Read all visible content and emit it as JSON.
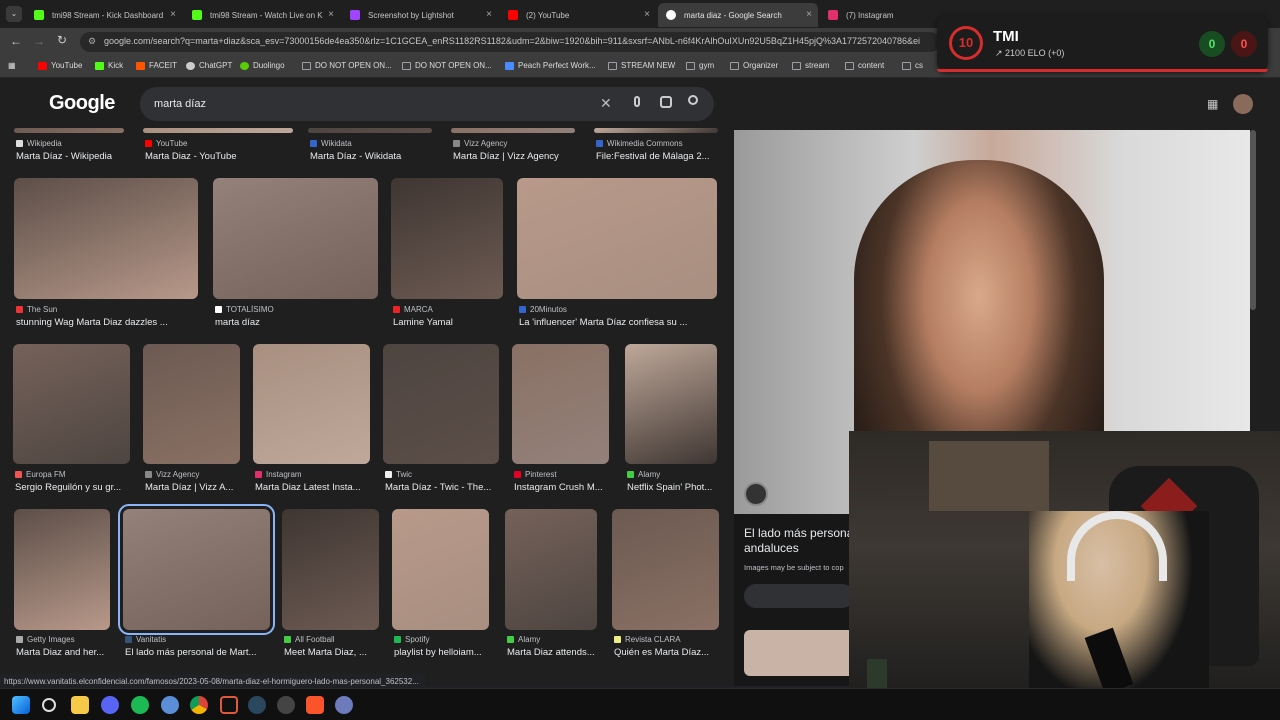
{
  "tabs": [
    {
      "label": "tmi98 Stream - Kick Dashboard",
      "color": "#53fc18"
    },
    {
      "label": "tmi98 Stream - Watch Live on K",
      "color": "#53fc18"
    },
    {
      "label": "Screenshot by Lightshot",
      "color": "#a044ff"
    },
    {
      "label": "(2) YouTube",
      "color": "#ff0000"
    },
    {
      "label": "marta diaz - Google Search",
      "color": "#ffffff"
    },
    {
      "label": "(7) Instagram",
      "color": "#e1306c"
    }
  ],
  "url": "google.com/search?q=marta+diaz&sca_esv=73000156de4ea350&rlz=1C1GCEA_enRS1182RS1182&udm=2&biw=1920&bih=911&sxsrf=ANbL-n6f4KrAlhOuIXUn92U5BqZ1H45pjQ%3A1772572040786&ei",
  "bookmarks": [
    {
      "label": "YouTube",
      "color": "#ff0000"
    },
    {
      "label": "Kick",
      "color": "#53fc18"
    },
    {
      "label": "FACEIT",
      "color": "#ff5500"
    },
    {
      "label": "ChatGPT",
      "color": "#cccccc"
    },
    {
      "label": "Duolingo",
      "color": "#58cc02"
    },
    {
      "label": "DO NOT OPEN ON...",
      "color": "#9aa0a6"
    },
    {
      "label": "DO NOT OPEN ON...",
      "color": "#9aa0a6"
    },
    {
      "label": "Peach Perfect Work...",
      "color": "#4a8cff"
    },
    {
      "label": "STREAM NEW",
      "color": "#9aa0a6"
    },
    {
      "label": "gym",
      "color": "#9aa0a6"
    },
    {
      "label": "Organizer",
      "color": "#9aa0a6"
    },
    {
      "label": "stream",
      "color": "#9aa0a6"
    },
    {
      "label": "content",
      "color": "#9aa0a6"
    },
    {
      "label": "cs",
      "color": "#9aa0a6"
    }
  ],
  "logo": "Google",
  "query": "marta díaz",
  "rows": [
    [
      {
        "src": "Wikipedia",
        "title": "Marta Díaz - Wikipedia",
        "c": "#ddd"
      },
      {
        "src": "YouTube",
        "title": "Marta Diaz - YouTube",
        "c": "#f00"
      },
      {
        "src": "Wikidata",
        "title": "Marta Díaz - Wikidata",
        "c": "#36c"
      },
      {
        "src": "Vizz Agency",
        "title": "Marta Díaz | Vizz Agency",
        "c": "#888"
      },
      {
        "src": "Wikimedia Commons",
        "title": "File:Festival de Málaga 2...",
        "c": "#36c"
      }
    ],
    [
      {
        "src": "The Sun",
        "title": "stunning Wag Marta Diaz dazzles ...",
        "c": "#e33"
      },
      {
        "src": "TOTALÍSIMO",
        "title": "marta díaz",
        "c": "#fff"
      },
      {
        "src": "MARCA",
        "title": "Lamine Yamal",
        "c": "#e22"
      },
      {
        "src": "20Minutos",
        "title": "La 'influencer' Marta Díaz confiesa su ...",
        "c": "#36c"
      }
    ],
    [
      {
        "src": "Europa FM",
        "title": "Sergio Reguilón y su gr...",
        "c": "#e55"
      },
      {
        "src": "Vizz Agency",
        "title": "Marta Díaz | Vizz A...",
        "c": "#888"
      },
      {
        "src": "Instagram",
        "title": "Marta Diaz Latest Insta...",
        "c": "#e1306c"
      },
      {
        "src": "Twic",
        "title": "Marta Díaz - Twic - The...",
        "c": "#eee"
      },
      {
        "src": "Pinterest",
        "title": "Instagram Crush M...",
        "c": "#e60023"
      },
      {
        "src": "Alamy",
        "title": "Netflix Spain' Phot...",
        "c": "#4c4"
      }
    ],
    [
      {
        "src": "Getty Images",
        "title": "Marta Diaz and her...",
        "c": "#aaa"
      },
      {
        "src": "Vanitatis",
        "title": "El lado más personal de Mart...",
        "c": "#357"
      },
      {
        "src": "All Football",
        "title": "Meet Marta Diaz, ...",
        "c": "#4c4"
      },
      {
        "src": "Spotify",
        "title": "playlist by helloiam...",
        "c": "#1db954"
      },
      {
        "src": "Alamy",
        "title": "Marta Diaz attends...",
        "c": "#4c4"
      },
      {
        "src": "Revista CLARA",
        "title": "Quién es Marta Díaz...",
        "c": "#ee8"
      }
    ]
  ],
  "panel": {
    "title": "El lado más persona andaluces",
    "notice": "Images may be subject to cop"
  },
  "status_url": "https://www.vanitatis.elconfidencial.com/famosos/2023-05-08/marta-diaz-el-hormiguero-lado-mas-personal_362532...",
  "overlay": {
    "level": "10",
    "name": "TMI",
    "elo": "2100 ELO (+0)",
    "wins": "0",
    "losses": "0"
  }
}
